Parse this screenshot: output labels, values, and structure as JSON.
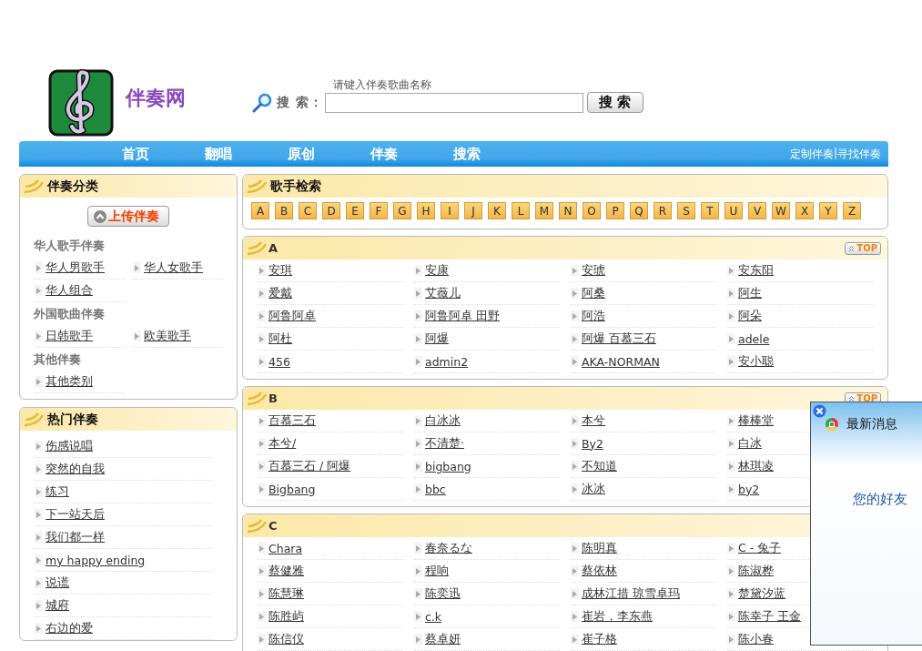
{
  "header": {
    "site_name": "伴奏网"
  },
  "search": {
    "hint": "请键入伴奏歌曲名称",
    "label": "搜 索：",
    "button": "搜 索"
  },
  "nav": {
    "items": [
      "首页",
      "翻唱",
      "原创",
      "伴奏",
      "搜索"
    ],
    "right_links": [
      "定制伴奏",
      "寻找伴奏"
    ],
    "separator": "|"
  },
  "categories": {
    "title": "伴奏分类",
    "upload_button": "上传伴奏",
    "groups": [
      {
        "title": "华人歌手伴奏",
        "items": [
          "华人男歌手",
          "华人女歌手",
          "华人组合"
        ]
      },
      {
        "title": "外国歌曲伴奏",
        "items": [
          "日韩歌手",
          "欧美歌手"
        ]
      },
      {
        "title": "其他伴奏",
        "items": [
          "其他类别"
        ]
      }
    ]
  },
  "hot": {
    "title": "热门伴奏",
    "items": [
      "伤感说唱",
      "突然的自我",
      "练习",
      "下一站天后",
      "我们都一样",
      "my happy ending",
      "说谎",
      "城府",
      "右边的爱"
    ]
  },
  "singer_search": {
    "title": "歌手检索",
    "letters": [
      "A",
      "B",
      "C",
      "D",
      "E",
      "F",
      "G",
      "H",
      "I",
      "J",
      "K",
      "L",
      "M",
      "N",
      "O",
      "P",
      "Q",
      "R",
      "S",
      "T",
      "U",
      "V",
      "W",
      "X",
      "Y",
      "Z"
    ]
  },
  "sections": [
    {
      "letter": "A",
      "top_button": "TOP",
      "singers": [
        "安琪",
        "安康",
        "安琥",
        "安东阳",
        "爱戴",
        "艾薇儿",
        "阿桑",
        "阿生",
        "阿鲁阿卓",
        "阿鲁阿卓 田野",
        "阿浩",
        "阿朵",
        "阿杜",
        "阿爆",
        "阿爆 百慕三石",
        "adele",
        "456",
        "admin2",
        "AKA-NORMAN",
        "安小聪"
      ]
    },
    {
      "letter": "B",
      "top_button": "TOP",
      "singers": [
        "百慕三石",
        "白冰冰",
        "本兮",
        "棒棒堂",
        "本兮/",
        "不清楚·",
        "By2",
        "白冰",
        "百慕三石 / 阿爆",
        "bigbang",
        "不知道",
        "林琪凌",
        "Bigbang",
        "bbc",
        "冰冰",
        "by2"
      ]
    },
    {
      "letter": "C",
      "singers": [
        "Chara",
        "春奈るな",
        "陈明真",
        "C - 兔子",
        "蔡健雅",
        "程响",
        "蔡依林",
        "陈淑桦",
        "陈慧琳",
        "陈奕迅",
        "成林江措 琼雪卓玛",
        "楚黛汐蓝",
        "陈胜屿",
        "c.k",
        "崔岩，李东燕",
        "陈幸子 王金",
        "陈信仪",
        "蔡卓妍",
        "崔子格",
        "陈小春"
      ]
    }
  ],
  "popup": {
    "title": "最新消息",
    "message": "您的好友"
  }
}
